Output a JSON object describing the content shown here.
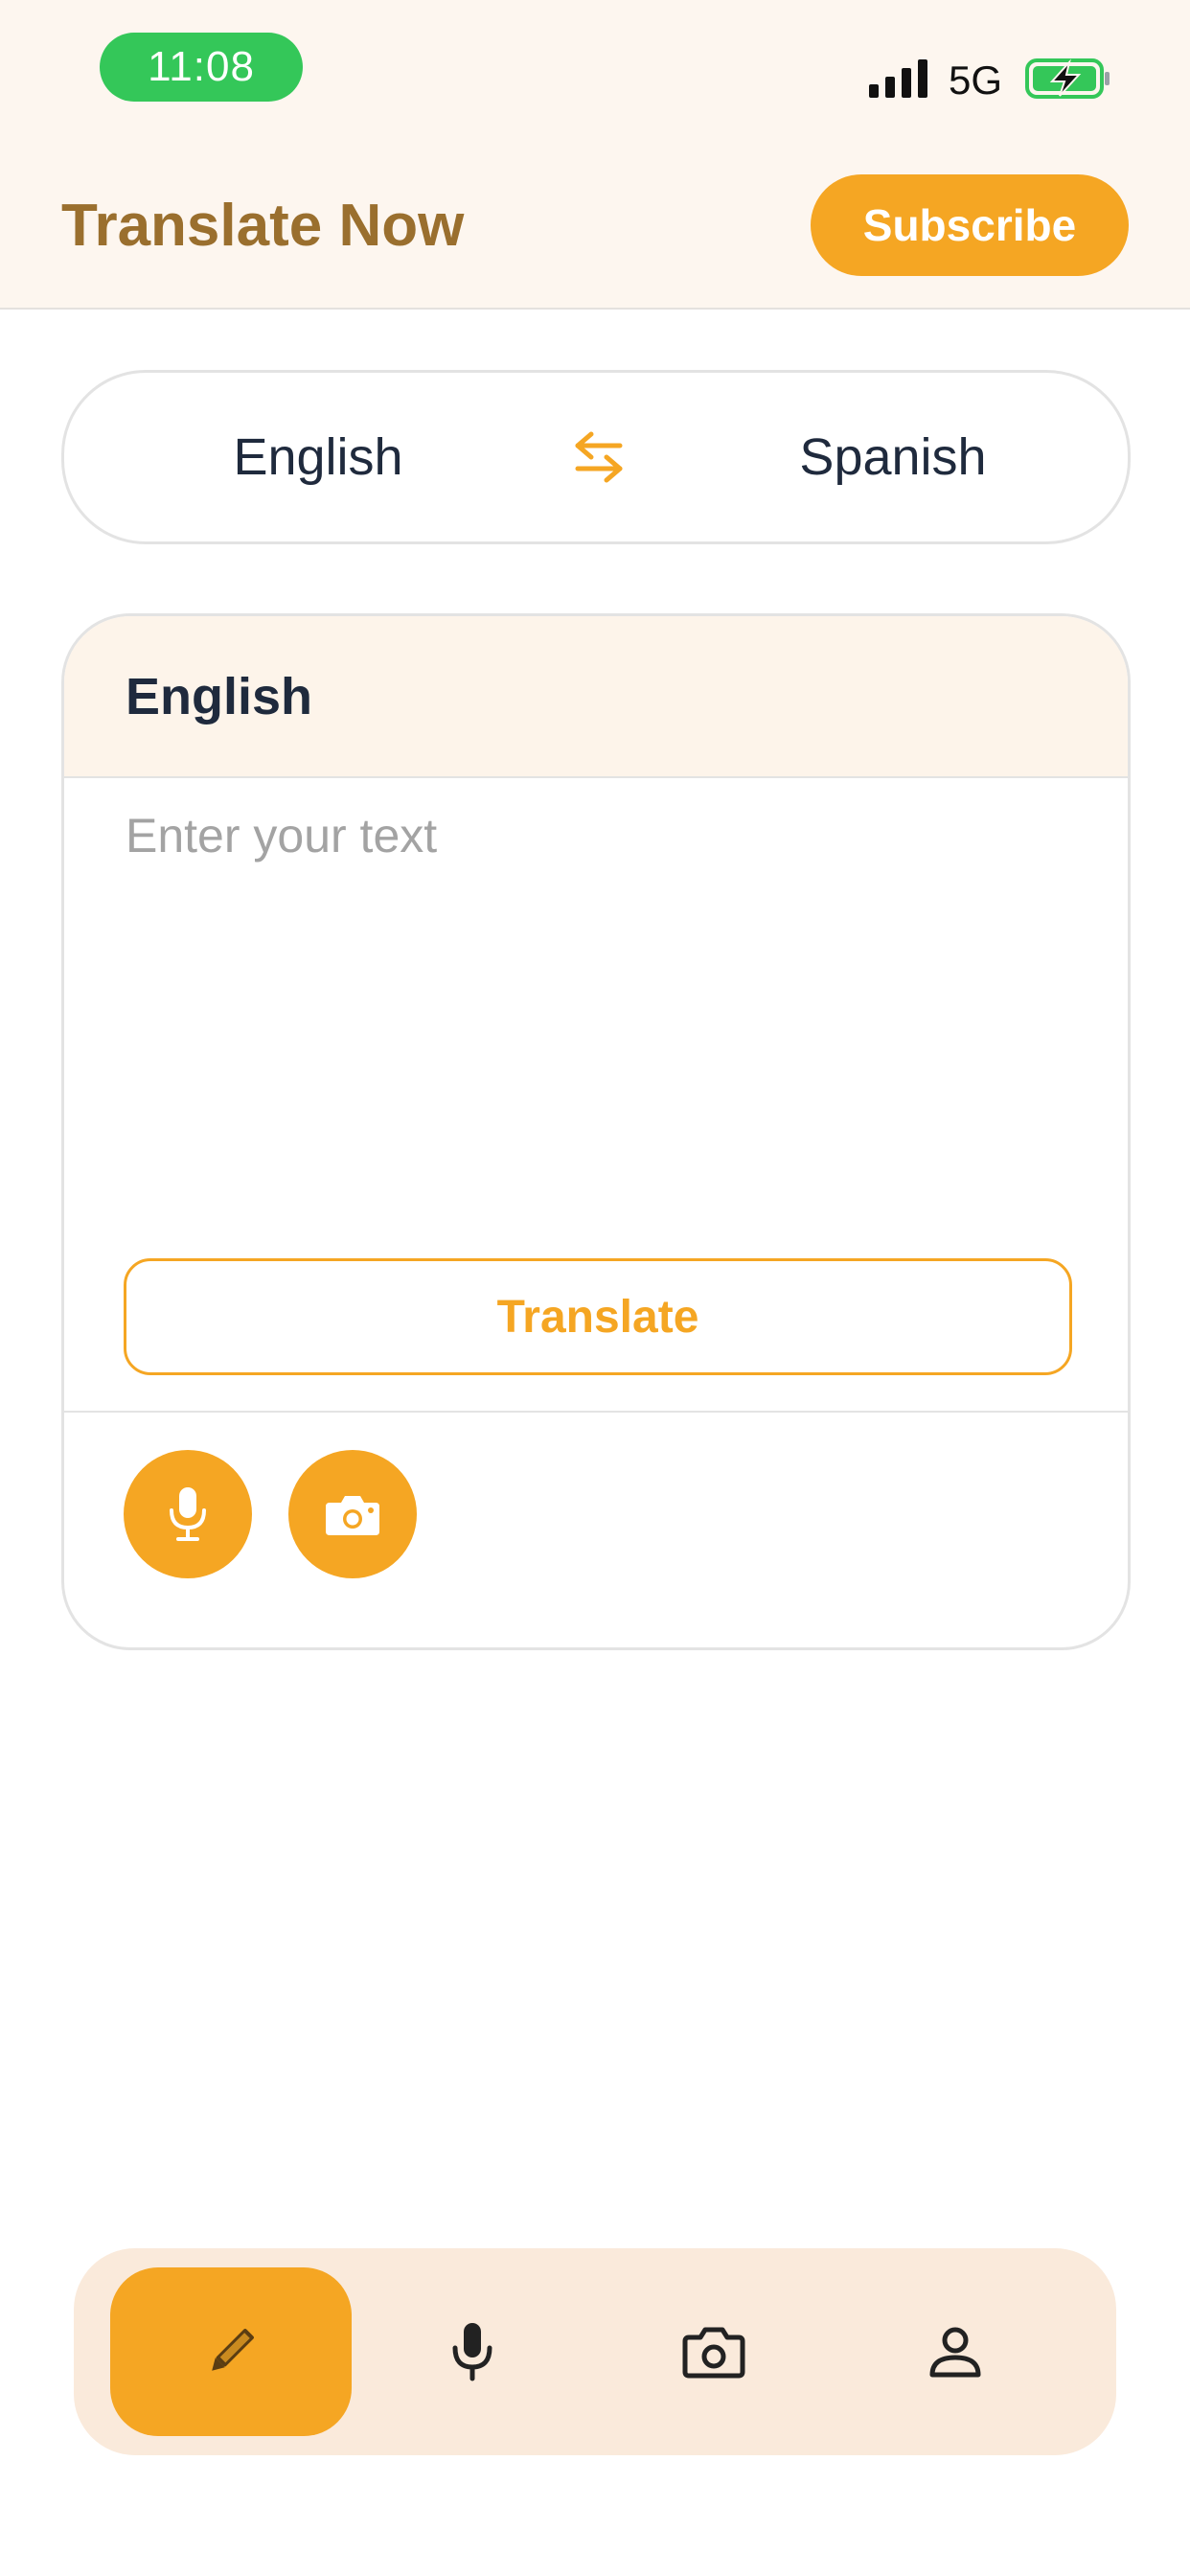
{
  "status_bar": {
    "time": "11:08",
    "network": "5G",
    "icons": [
      "signal-bars-icon",
      "battery-charging-icon"
    ],
    "time_pill_color": "#34c759"
  },
  "header": {
    "title": "Translate Now",
    "subscribe_label": "Subscribe"
  },
  "language_selector": {
    "source": "English",
    "target": "Spanish",
    "swap_icon": "swap-arrows-icon"
  },
  "input_card": {
    "header_label": "English",
    "text_value": "",
    "placeholder": "Enter your text",
    "translate_label": "Translate",
    "actions": [
      "microphone-icon",
      "camera-icon"
    ]
  },
  "bottom_nav": {
    "items": [
      {
        "icon": "pencil-icon",
        "active": true
      },
      {
        "icon": "microphone-icon",
        "active": false
      },
      {
        "icon": "camera-icon",
        "active": false
      },
      {
        "icon": "person-icon",
        "active": false
      }
    ]
  },
  "colors": {
    "accent": "#f5a623",
    "title": "#9a6f2e",
    "header_bg": "#fdf6ef",
    "nav_bg": "#faeadb",
    "text_dark": "#1f2a3d"
  }
}
